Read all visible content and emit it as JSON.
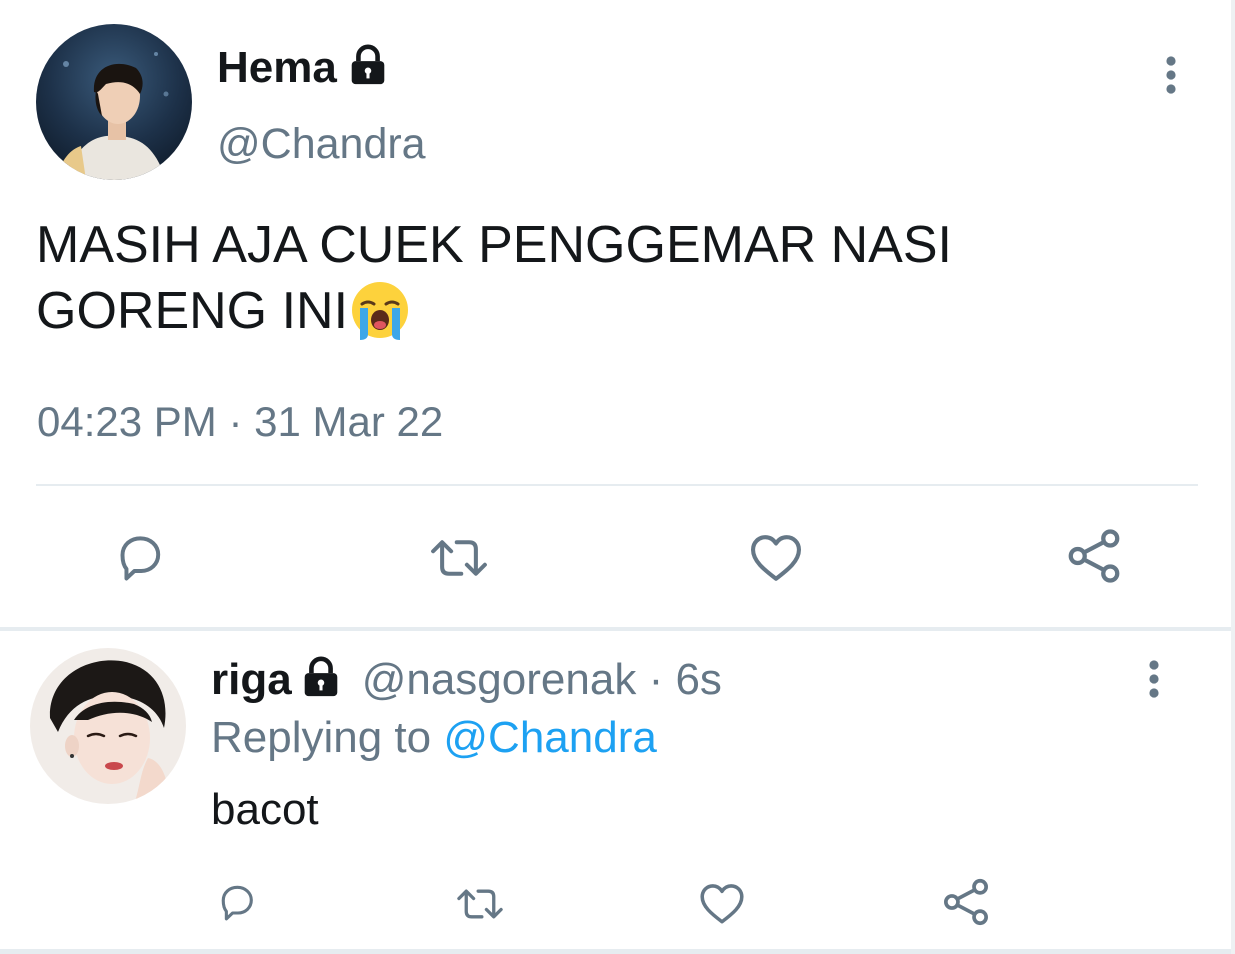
{
  "tweet": {
    "author": {
      "display_name": "Hema",
      "handle": "@Chandra",
      "avatar_icon": "profile-photo",
      "locked_icon": "lock-icon"
    },
    "text": "MASIH AJA CUEK PENGGEMAR NASI GORENG INI",
    "emoji": "loudly-crying-face",
    "timestamp": "04:23 PM · 31 Mar 22",
    "actions": [
      "reply-icon",
      "retweet-icon",
      "like-icon",
      "share-icon"
    ]
  },
  "reply": {
    "author": {
      "display_name": "riga",
      "handle": "@nasgorenak",
      "age": "· 6s",
      "avatar_icon": "profile-photo",
      "locked_icon": "lock-icon"
    },
    "replying_prefix": "Replying to",
    "replying_to": "@Chandra",
    "text": "bacot",
    "actions": [
      "reply-icon",
      "retweet-icon",
      "like-icon",
      "share-icon"
    ]
  },
  "colors": {
    "text_primary": "#14171a",
    "text_secondary": "#657786",
    "link": "#1da1f2",
    "divider": "#e6ecf0"
  }
}
